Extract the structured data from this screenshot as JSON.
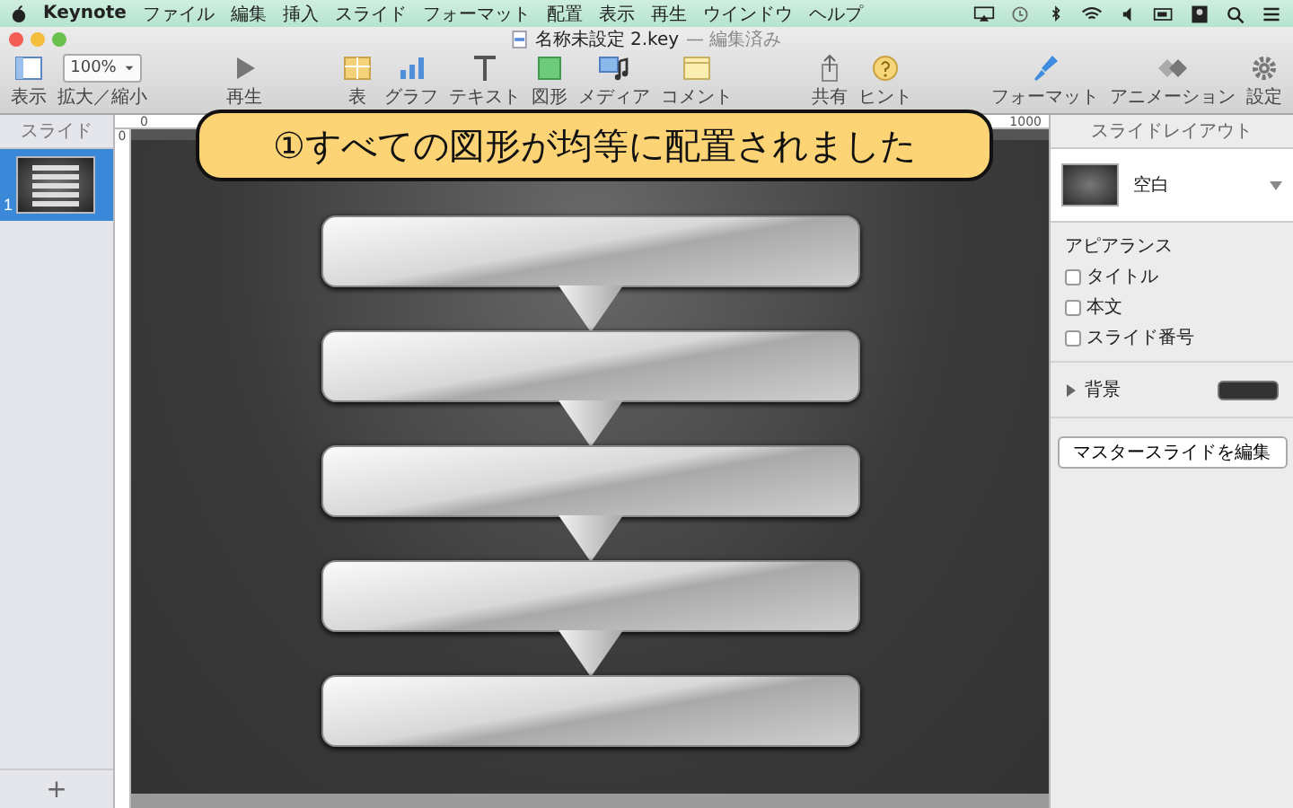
{
  "menu_bar": {
    "app": "Keynote",
    "items": [
      "ファイル",
      "編集",
      "挿入",
      "スライド",
      "フォーマット",
      "配置",
      "表示",
      "再生",
      "ウインドウ",
      "ヘルプ"
    ]
  },
  "window": {
    "title": "名称未設定 2.key",
    "status": "— 編集済み"
  },
  "toolbar": {
    "items": [
      {
        "kind": "view",
        "label": "表示"
      },
      {
        "kind": "zoom",
        "label": "拡大／縮小",
        "value": "100%"
      },
      {
        "kind": "play",
        "label": "再生"
      },
      {
        "kind": "table",
        "label": "表"
      },
      {
        "kind": "chart",
        "label": "グラフ"
      },
      {
        "kind": "text",
        "label": "テキスト"
      },
      {
        "kind": "shape",
        "label": "図形"
      },
      {
        "kind": "media",
        "label": "メディア"
      },
      {
        "kind": "comment",
        "label": "コメント"
      },
      {
        "kind": "share",
        "label": "共有"
      },
      {
        "kind": "tips",
        "label": "ヒント"
      },
      {
        "kind": "format",
        "label": "フォーマット"
      },
      {
        "kind": "animate",
        "label": "アニメーション"
      },
      {
        "kind": "setup",
        "label": "設定"
      }
    ]
  },
  "sidebar": {
    "title": "スライド",
    "slides": [
      {
        "number": "1",
        "selected": true
      }
    ],
    "add": "+"
  },
  "ruler": {
    "start": "0",
    "end": "1000",
    "vertical_start": "0"
  },
  "slide": {
    "shapes": [
      {
        "kind": "bar"
      },
      {
        "kind": "bar"
      },
      {
        "kind": "bar"
      },
      {
        "kind": "bar"
      },
      {
        "kind": "bar"
      }
    ]
  },
  "callout": "①すべての図形が均等に配置されました",
  "inspector": {
    "title": "スライドレイアウト",
    "layout": "空白",
    "appearance_title": "アピアランス",
    "options": [
      {
        "label": "タイトル",
        "checked": false
      },
      {
        "label": "本文",
        "checked": false
      },
      {
        "label": "スライド番号",
        "checked": false
      }
    ],
    "background": {
      "label": "背景",
      "expanded": false
    },
    "button": "マスタースライドを編集"
  }
}
